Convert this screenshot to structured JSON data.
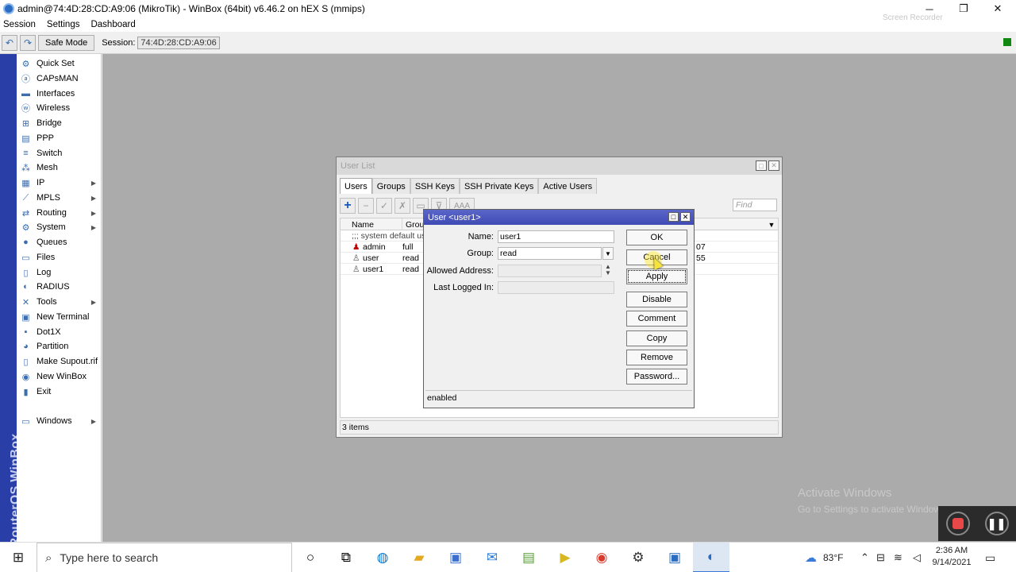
{
  "window": {
    "title": "admin@74:4D:28:CD:A9:06 (MikroTik) - WinBox (64bit) v6.46.2 on hEX S (mmips)",
    "minimize": "─",
    "restore": "❐",
    "close": "✕"
  },
  "menu": [
    "Session",
    "Settings",
    "Dashboard"
  ],
  "toolbar": {
    "undo": "↶",
    "redo": "↷",
    "safe_mode": "Safe Mode",
    "session_label": "Session:",
    "session_value": "74:4D:28:CD:A9:06"
  },
  "brand": "RouterOS WinBox",
  "sidebar": {
    "items": [
      {
        "label": "Quick Set",
        "icon": "quick-set-icon",
        "glyph": "⚙",
        "arrow": false
      },
      {
        "label": "CAPsMAN",
        "icon": "capsman-icon",
        "glyph": "ⓐ",
        "arrow": false
      },
      {
        "label": "Interfaces",
        "icon": "interfaces-icon",
        "glyph": "▬",
        "arrow": false
      },
      {
        "label": "Wireless",
        "icon": "wireless-icon",
        "glyph": "ⓦ",
        "arrow": false
      },
      {
        "label": "Bridge",
        "icon": "bridge-icon",
        "glyph": "⊞",
        "arrow": false
      },
      {
        "label": "PPP",
        "icon": "ppp-icon",
        "glyph": "▤",
        "arrow": false
      },
      {
        "label": "Switch",
        "icon": "switch-icon",
        "glyph": "≡",
        "arrow": false
      },
      {
        "label": "Mesh",
        "icon": "mesh-icon",
        "glyph": "⁂",
        "arrow": false
      },
      {
        "label": "IP",
        "icon": "ip-icon",
        "glyph": "▦",
        "arrow": true
      },
      {
        "label": "MPLS",
        "icon": "mpls-icon",
        "glyph": "⟋",
        "arrow": true
      },
      {
        "label": "Routing",
        "icon": "routing-icon",
        "glyph": "⇄",
        "arrow": true
      },
      {
        "label": "System",
        "icon": "system-icon",
        "glyph": "⚙",
        "arrow": true
      },
      {
        "label": "Queues",
        "icon": "queues-icon",
        "glyph": "●",
        "arrow": false
      },
      {
        "label": "Files",
        "icon": "files-icon",
        "glyph": "▭",
        "arrow": false
      },
      {
        "label": "Log",
        "icon": "log-icon",
        "glyph": "▯",
        "arrow": false
      },
      {
        "label": "RADIUS",
        "icon": "radius-icon",
        "glyph": "◐",
        "arrow": false
      },
      {
        "label": "Tools",
        "icon": "tools-icon",
        "glyph": "✕",
        "arrow": true
      },
      {
        "label": "New Terminal",
        "icon": "terminal-icon",
        "glyph": "▣",
        "arrow": false
      },
      {
        "label": "Dot1X",
        "icon": "dot1x-icon",
        "glyph": "▪",
        "arrow": false
      },
      {
        "label": "Partition",
        "icon": "partition-icon",
        "glyph": "◕",
        "arrow": false
      },
      {
        "label": "Make Supout.rif",
        "icon": "supout-icon",
        "glyph": "▯",
        "arrow": false
      },
      {
        "label": "New WinBox",
        "icon": "winbox-icon",
        "glyph": "◉",
        "arrow": false
      },
      {
        "label": "Exit",
        "icon": "exit-icon",
        "glyph": "▮",
        "arrow": false
      },
      {
        "label": "Windows",
        "icon": "windows-icon",
        "glyph": "▭",
        "arrow": true
      }
    ]
  },
  "user_list": {
    "title": "User List",
    "tabs": [
      "Users",
      "Groups",
      "SSH Keys",
      "SSH Private Keys",
      "Active Users"
    ],
    "toolbar": {
      "add": "+",
      "remove": "−",
      "enable": "✓",
      "disable": "✗",
      "comment": "▭",
      "filter": "⊽",
      "aaa": "AAA"
    },
    "find_placeholder": "Find",
    "columns": [
      "Name",
      "Group"
    ],
    "comment_row": ";;; system default use",
    "rows": [
      {
        "name": "admin",
        "group": "full",
        "extra": "07"
      },
      {
        "name": "user",
        "group": "read",
        "extra": "55"
      },
      {
        "name": "user1",
        "group": "read",
        "extra": ""
      }
    ],
    "status": "3 items"
  },
  "dialog": {
    "title": "User <user1>",
    "fields": {
      "name_label": "Name:",
      "name_value": "user1",
      "group_label": "Group:",
      "group_value": "read",
      "allowed_label": "Allowed Address:",
      "allowed_value": "",
      "last_label": "Last Logged In:",
      "last_value": ""
    },
    "buttons": [
      "OK",
      "Cancel",
      "Apply",
      "Disable",
      "Comment",
      "Copy",
      "Remove",
      "Password..."
    ],
    "status": "enabled"
  },
  "watermark": {
    "line1": "Activate Windows",
    "line2": "Go to Settings to activate Windows.",
    "recorder": "Screen Recorder"
  },
  "taskbar": {
    "search_placeholder": "Type here to search",
    "weather": "83°F",
    "time": "2:36 AM",
    "date": "9/14/2021"
  }
}
